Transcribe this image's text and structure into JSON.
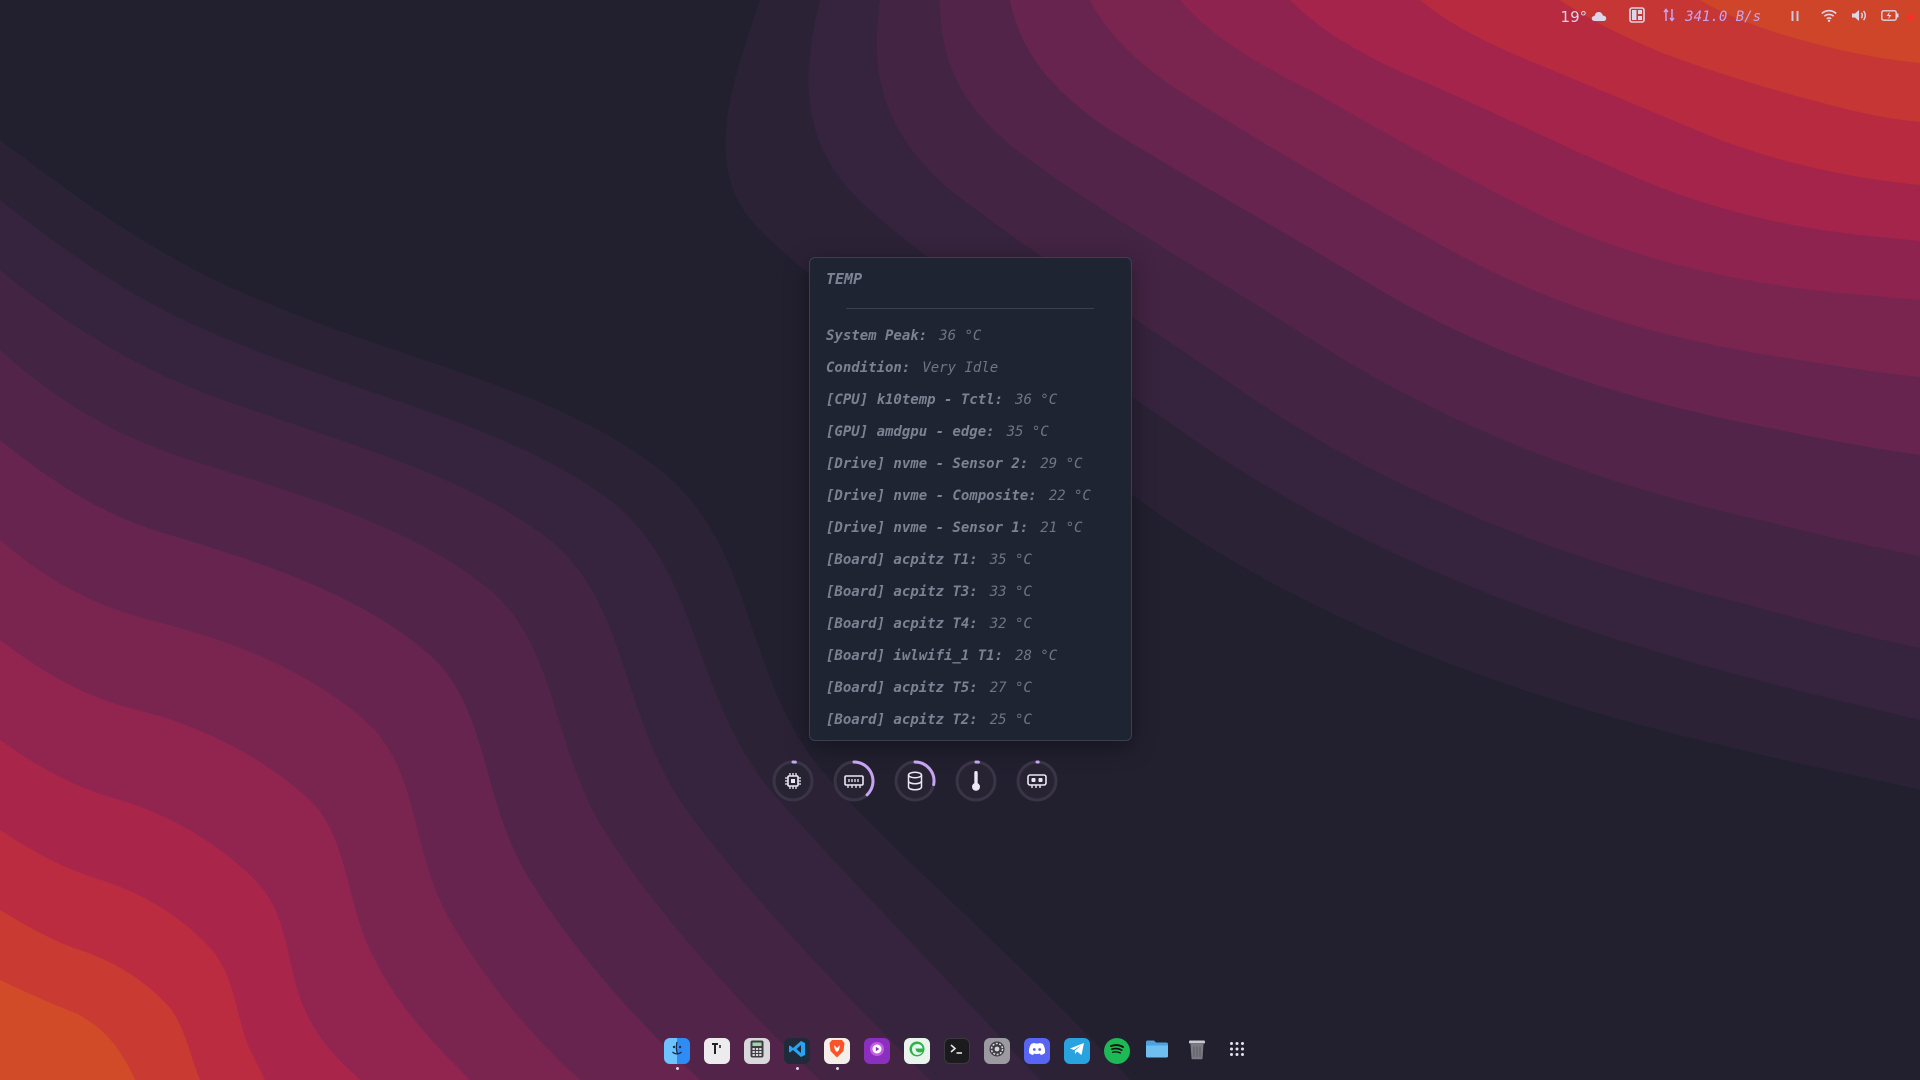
{
  "topbar": {
    "weather_temp": "19°",
    "weather_icon": "cloud-icon",
    "network_speed": "341.0 B/s",
    "network_icon": "up-down-arrows-icon"
  },
  "temp_panel": {
    "title": "TEMP",
    "rows": [
      {
        "label": "System Peak:",
        "value": "36 °C"
      },
      {
        "label": "Condition:",
        "value": "Very Idle"
      },
      {
        "label": "[CPU] k10temp - Tctl:",
        "value": "36 °C"
      },
      {
        "label": "[GPU] amdgpu - edge:",
        "value": "35 °C"
      },
      {
        "label": "[Drive] nvme - Sensor 2:",
        "value": "29 °C"
      },
      {
        "label": "[Drive] nvme - Composite:",
        "value": "22 °C"
      },
      {
        "label": "[Drive] nvme - Sensor 1:",
        "value": "21 °C"
      },
      {
        "label": "[Board] acpitz T1:",
        "value": "35 °C"
      },
      {
        "label": "[Board] acpitz T3:",
        "value": "33 °C"
      },
      {
        "label": "[Board] acpitz T4:",
        "value": "32 °C"
      },
      {
        "label": "[Board] iwlwifi_1 T1:",
        "value": "28 °C"
      },
      {
        "label": "[Board] acpitz T5:",
        "value": "27 °C"
      },
      {
        "label": "[Board] acpitz T2:",
        "value": "25 °C"
      }
    ]
  },
  "widgets": [
    {
      "name": "cpu-usage-ring",
      "icon": "cpu-chip-icon",
      "level": 0.02
    },
    {
      "name": "memory-usage-ring",
      "icon": "memory-ram-icon",
      "level": 0.38
    },
    {
      "name": "disk-usage-ring",
      "icon": "disk-database-icon",
      "level": 0.28
    },
    {
      "name": "temperature-ring",
      "icon": "thermometer-icon",
      "level": 0.02
    },
    {
      "name": "gpu-usage-ring",
      "icon": "gpu-card-icon",
      "level": 0.0
    }
  ],
  "dock": [
    {
      "name": "finder",
      "icon": "finder-icon",
      "color": "#2f8cf5",
      "running": true
    },
    {
      "name": "typora",
      "icon": "typora-icon",
      "color": "#e8e8ea",
      "running": false
    },
    {
      "name": "calculator",
      "icon": "calculator-icon",
      "color": "#3c3c3c",
      "running": false
    },
    {
      "name": "vscode",
      "icon": "vscode-icon",
      "color": "#1f2b3a",
      "running": true
    },
    {
      "name": "brave",
      "icon": "brave-icon",
      "color": "#fb542b",
      "running": true
    },
    {
      "name": "celluloid",
      "icon": "media-player-icon",
      "color": "#a23ec9",
      "running": false
    },
    {
      "name": "edge",
      "icon": "edge-icon",
      "color": "#2db24a",
      "running": false
    },
    {
      "name": "terminal",
      "icon": "terminal-icon",
      "color": "#1e1e1e",
      "running": false
    },
    {
      "name": "settings",
      "icon": "settings-gear-icon",
      "color": "#8a8a90",
      "running": false
    },
    {
      "name": "discord",
      "icon": "discord-icon",
      "color": "#5865f2",
      "running": false
    },
    {
      "name": "telegram",
      "icon": "telegram-icon",
      "color": "#29a3e0",
      "running": false
    },
    {
      "name": "spotify",
      "icon": "spotify-icon",
      "color": "#1db954",
      "running": false
    },
    {
      "name": "files",
      "icon": "folder-icon",
      "color": "#4aa3df",
      "running": false
    },
    {
      "name": "trash",
      "icon": "trash-icon",
      "color": "#6b6b6f",
      "running": false
    },
    {
      "name": "app-grid",
      "icon": "app-grid-icon",
      "color": "transparent",
      "running": false
    }
  ],
  "colors": {
    "accent": "#c6a4f2",
    "panel_bg": "#1f2432",
    "recording_dot": "#ff2a2a"
  }
}
